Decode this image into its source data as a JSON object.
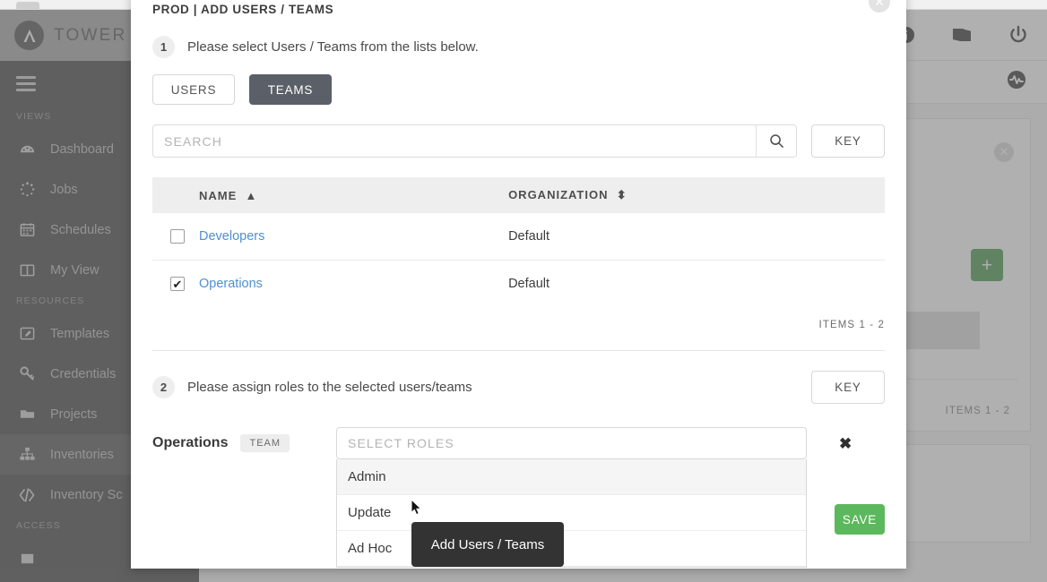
{
  "app": {
    "brand": {
      "name": "TOWER",
      "logo_icon": "ansible-logo-icon"
    },
    "sidebar": {
      "menu_icon": "hamburger-menu-icon",
      "sections": [
        {
          "label": "VIEWS",
          "items": [
            {
              "label": "Dashboard",
              "icon": "dashboard-gauge-icon",
              "active": false
            },
            {
              "label": "Jobs",
              "icon": "jobs-spinner-icon",
              "active": false
            },
            {
              "label": "Schedules",
              "icon": "calendar-icon",
              "active": false
            },
            {
              "label": "My View",
              "icon": "columns-icon",
              "active": false
            }
          ]
        },
        {
          "label": "RESOURCES",
          "items": [
            {
              "label": "Templates",
              "icon": "template-pencil-icon",
              "active": false
            },
            {
              "label": "Credentials",
              "icon": "key-icon",
              "active": false
            },
            {
              "label": "Projects",
              "icon": "folder-icon",
              "active": false
            },
            {
              "label": "Inventories",
              "icon": "inventory-sitemap-icon",
              "active": true
            },
            {
              "label": "Inventory Sc",
              "icon": "code-brackets-icon",
              "active": false
            }
          ]
        },
        {
          "label": "ACCESS",
          "items": []
        }
      ]
    },
    "topbar": {
      "icons": [
        {
          "name": "user-info-icon"
        },
        {
          "name": "docs-book-icon"
        },
        {
          "name": "power-logout-icon"
        }
      ]
    },
    "subbar": {
      "icon": "activity-pulse-icon"
    },
    "background_panel": {
      "close_icon": "close-circle-icon",
      "add_icon": "plus-icon",
      "items_count": "ITEMS  1 - 2"
    }
  },
  "modal": {
    "title": "PROD | ADD USERS / TEAMS",
    "close_icon": "modal-close-icon",
    "step1": {
      "number": "1",
      "text": "Please select Users / Teams from the lists below.",
      "tabs": [
        {
          "label": "USERS",
          "selected": false
        },
        {
          "label": "TEAMS",
          "selected": true
        }
      ]
    },
    "search": {
      "placeholder": "SEARCH",
      "value": "",
      "icon": "search-magnifier-icon",
      "key_label": "KEY"
    },
    "table": {
      "columns": [
        {
          "label": "NAME",
          "sort": "asc",
          "sort_icon": "caret-up-icon"
        },
        {
          "label": "ORGANIZATION",
          "sort": "none",
          "sort_icon": "caret-updown-icon"
        }
      ],
      "rows": [
        {
          "checked": false,
          "name": "Developers",
          "organization": "Default"
        },
        {
          "checked": true,
          "name": "Operations",
          "organization": "Default"
        }
      ],
      "items_count": "ITEMS  1 - 2"
    },
    "step2": {
      "number": "2",
      "text": "Please assign roles to the selected users/teams",
      "key_label": "KEY"
    },
    "assignment": {
      "name": "Operations",
      "badge": "TEAM",
      "roles_placeholder": "SELECT ROLES",
      "roles_value": "",
      "remove_icon": "remove-x-icon",
      "dropdown_options": [
        {
          "label": "Admin",
          "highlighted": true
        },
        {
          "label": "Update",
          "highlighted": false
        },
        {
          "label": "Ad Hoc",
          "highlighted": false
        }
      ]
    },
    "save_label": "SAVE"
  },
  "tooltip": {
    "text": "Add Users / Teams"
  }
}
